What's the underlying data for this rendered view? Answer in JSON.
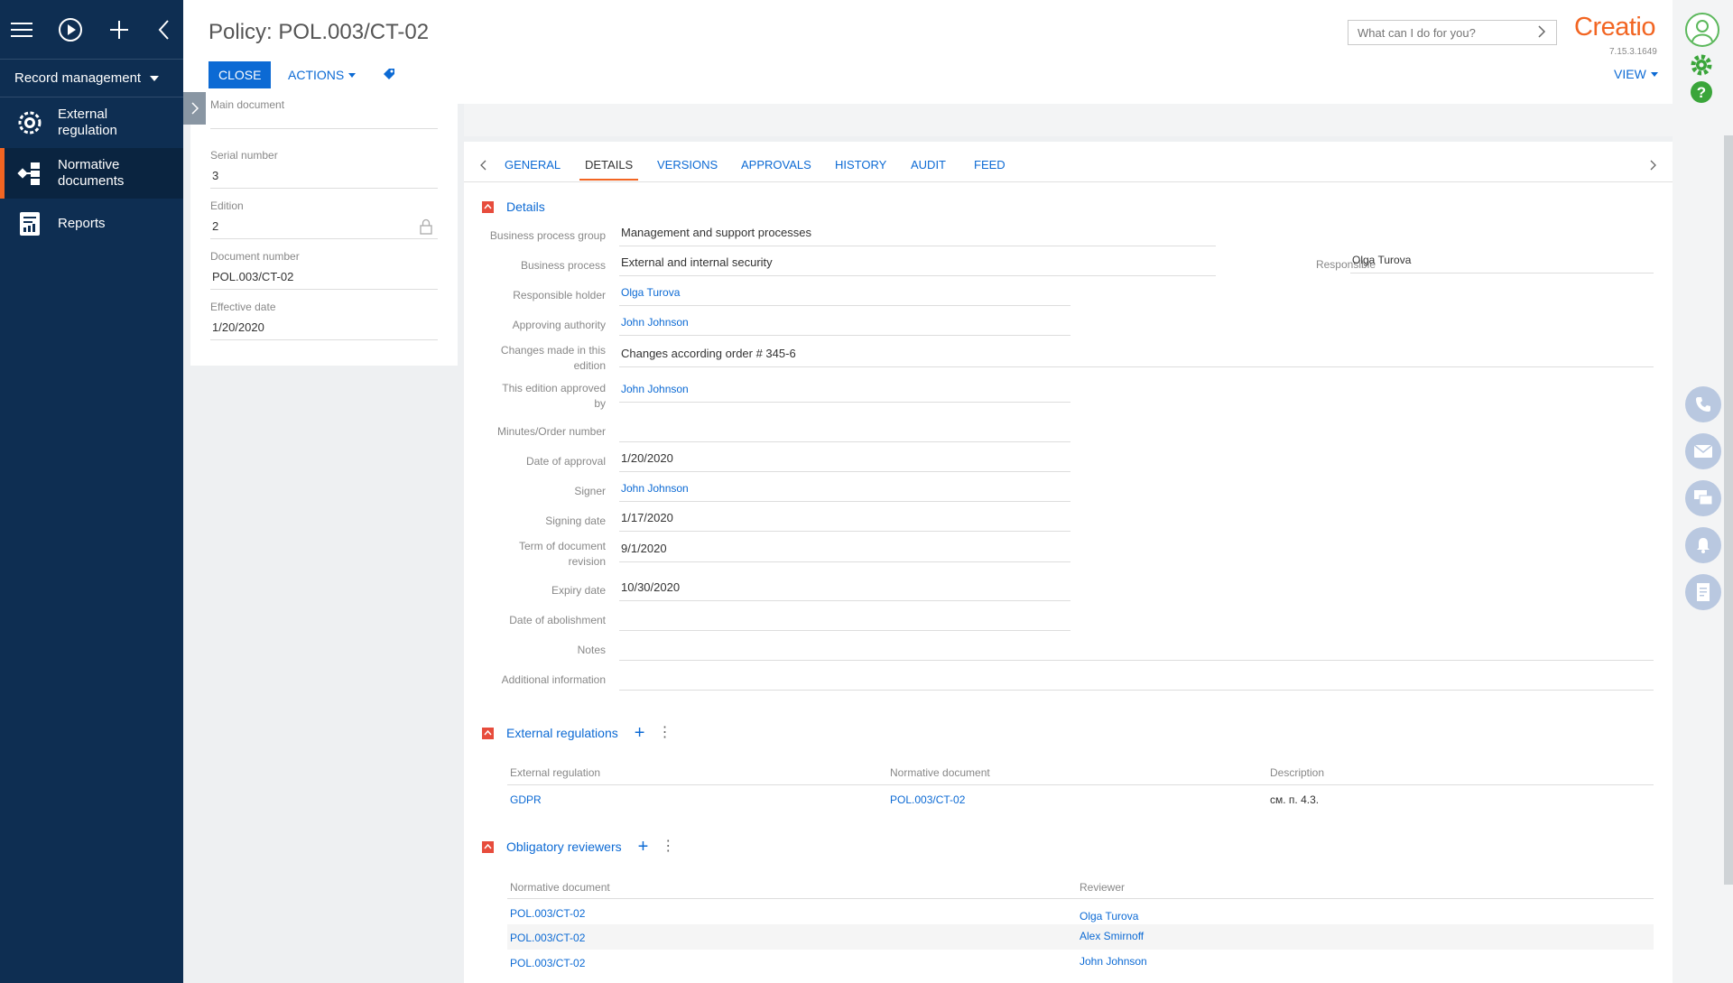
{
  "nav": {
    "workplace": "Record management",
    "items": [
      {
        "label_line1": "External",
        "label_line2": "regulation"
      },
      {
        "label_line1": "Normative",
        "label_line2": "documents"
      },
      {
        "label_line1": "Reports",
        "label_line2": ""
      }
    ]
  },
  "header": {
    "title": "Policy: POL.003/CT-02",
    "close_label": "CLOSE",
    "actions_label": "ACTIONS",
    "search_placeholder": "What can I do for you?",
    "logo": "Creatio",
    "version": "7.15.3.1649",
    "view_label": "VIEW"
  },
  "left_fields": [
    {
      "label": "Main document",
      "value": ""
    },
    {
      "label": "Serial number",
      "value": "3"
    },
    {
      "label": "Edition",
      "value": "2"
    },
    {
      "label": "Document number",
      "value": "POL.003/CT-02"
    },
    {
      "label": "Effective date",
      "value": "1/20/2020"
    }
  ],
  "tabs": [
    "GENERAL",
    "DETAILS",
    "VERSIONS",
    "APPROVALS",
    "HISTORY",
    "AUDIT",
    "FEED"
  ],
  "details": {
    "title": "Details",
    "fields": {
      "bp_group_label": "Business process group",
      "bp_group_value": "Management and support processes",
      "bp_label": "Business process",
      "bp_value": "External and internal security",
      "responsible_label": "Responsible",
      "responsible_value": "Olga Turova",
      "holder_label": "Responsible holder",
      "holder_value": "Olga Turova",
      "authority_label": "Approving authority",
      "authority_value": "John Johnson",
      "changes_label_1": "Changes made in this",
      "changes_label_2": "edition",
      "changes_value": "Changes according order # 345-6",
      "approvedby_label_1": "This edition approved",
      "approvedby_label_2": "by",
      "approvedby_value": "John Johnson",
      "minutes_label": "Minutes/Order number",
      "minutes_value": "",
      "approval_date_label": "Date of approval",
      "approval_date_value": "1/20/2020",
      "signer_label": "Signer",
      "signer_value": "John Johnson",
      "signing_date_label": "Signing date",
      "signing_date_value": "1/17/2020",
      "revision_label_1": "Term of document",
      "revision_label_2": "revision",
      "revision_value": "9/1/2020",
      "expiry_label": "Expiry date",
      "expiry_value": "10/30/2020",
      "abolishment_label": "Date of abolishment",
      "abolishment_value": "",
      "notes_label": "Notes",
      "notes_value": "",
      "additional_label": "Additional information",
      "additional_value": ""
    }
  },
  "ext_regs": {
    "title": "External regulations",
    "columns": [
      "External regulation",
      "Normative document",
      "Description"
    ],
    "rows": [
      {
        "regulation": "GDPR",
        "document": "POL.003/CT-02",
        "description": "см. п. 4.3."
      }
    ]
  },
  "reviewers": {
    "title": "Obligatory reviewers",
    "columns": [
      "Normative document",
      "Reviewer"
    ],
    "rows": [
      {
        "document": "POL.003/CT-02",
        "reviewer": "Olga Turova"
      },
      {
        "document": "POL.003/CT-02",
        "reviewer": "Alex Smirnoff"
      },
      {
        "document": "POL.003/CT-02",
        "reviewer": "John Johnson"
      }
    ]
  },
  "colors": {
    "nav_bg": "#0e2e52",
    "accent": "#f26522",
    "link": "#0c6ad4"
  }
}
